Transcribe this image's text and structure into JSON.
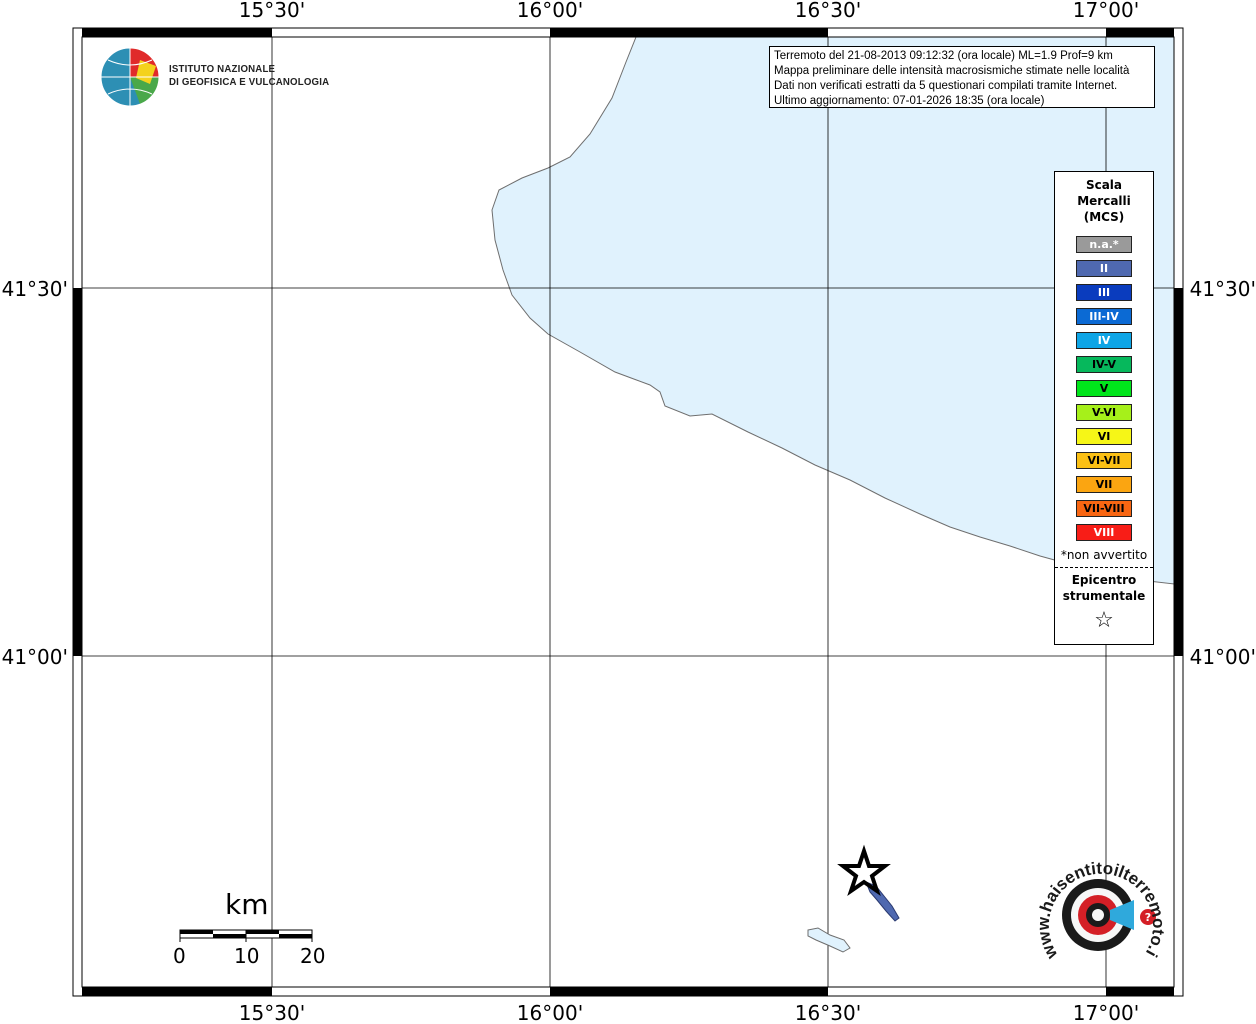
{
  "map": {
    "longitude_labels": [
      "15°30'",
      "16°00'",
      "16°30'",
      "17°00'"
    ],
    "latitude_labels": [
      "41°30'",
      "41°00'"
    ],
    "land_color": "#ffffff",
    "sea_color": "#e0f2fd"
  },
  "logo": {
    "line1": "ISTITUTO NAZIONALE",
    "line2": "DI GEOFISICA E VULCANOLOGIA"
  },
  "info": {
    "line1": "Terremoto del 21-08-2013 09:12:32 (ora locale) ML=1.9 Prof=9 km",
    "line2": "Mappa preliminare delle intensità macrosismiche stimate nelle località",
    "line3": "Dati non verificati estratti da 5 questionari compilati tramite Internet.",
    "line4": "Ultimo aggiornamento: 07-01-2026 18:35 (ora locale)"
  },
  "legend": {
    "title_line1": "Scala",
    "title_line2": "Mercalli",
    "title_line3": "(MCS)",
    "levels": [
      {
        "label": "n.a.*",
        "color": "#9a9a9a",
        "dark_text": false
      },
      {
        "label": "II",
        "color": "#4f69b0",
        "dark_text": false
      },
      {
        "label": "III",
        "color": "#0a3cbe",
        "dark_text": false
      },
      {
        "label": "III-IV",
        "color": "#0b6ad4",
        "dark_text": false
      },
      {
        "label": "IV",
        "color": "#0ea5e6",
        "dark_text": false
      },
      {
        "label": "IV-V",
        "color": "#06b85c",
        "dark_text": true
      },
      {
        "label": "V",
        "color": "#00e51b",
        "dark_text": true
      },
      {
        "label": "V-VI",
        "color": "#a6f01a",
        "dark_text": true
      },
      {
        "label": "VI",
        "color": "#f6f617",
        "dark_text": true
      },
      {
        "label": "VI-VII",
        "color": "#fbc014",
        "dark_text": true
      },
      {
        "label": "VII",
        "color": "#fba511",
        "dark_text": true
      },
      {
        "label": "VII-VIII",
        "color": "#f86612",
        "dark_text": true
      },
      {
        "label": "VIII",
        "color": "#f81d17",
        "dark_text": false
      }
    ],
    "not_felt_note": "*non avvertito",
    "epicenter_line1": "Epicentro",
    "epicenter_line2": "strumentale",
    "epicenter_symbol": "☆"
  },
  "scale_bar": {
    "unit": "km",
    "labels": [
      "0",
      "10",
      "20"
    ]
  },
  "hsit_logo": {
    "text": "www.haisentitoilterremoto.it"
  }
}
